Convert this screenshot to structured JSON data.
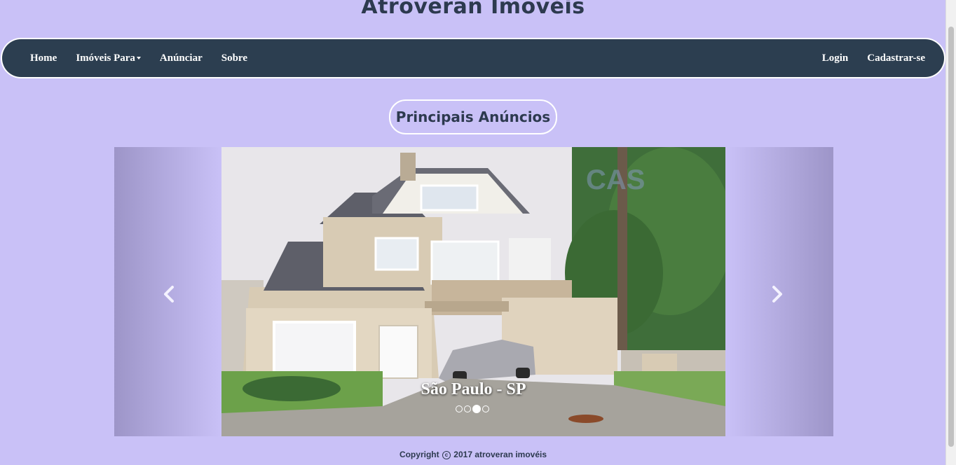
{
  "header": {
    "title": "Atroveran Imovéis"
  },
  "navbar": {
    "left_items": [
      {
        "label": "Home"
      },
      {
        "label": "Imóveis Para"
      },
      {
        "label": "Anúnciar"
      },
      {
        "label": "Sobre"
      }
    ],
    "right_items": [
      {
        "label": "Login"
      },
      {
        "label": "Cadastrar-se"
      }
    ]
  },
  "main": {
    "section_title": "Principais Anúncios",
    "carousel": {
      "caption": "São Paulo - SP",
      "indicator_count": 4,
      "active_index": 2,
      "prev_icon": "chevron-left-icon",
      "next_icon": "chevron-right-icon"
    }
  },
  "footer": {
    "copyright_prefix": "Copyright",
    "copyright_symbol": "c",
    "copyright_rest": "2017 atroveran imovéis"
  },
  "colors": {
    "background": "#c9c1f7",
    "navbar": "#2c3e50",
    "text_dark": "#2d3a4f"
  }
}
